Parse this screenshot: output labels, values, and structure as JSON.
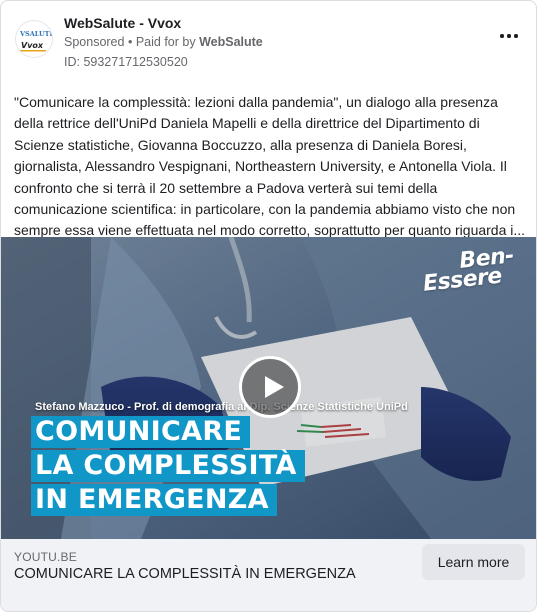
{
  "header": {
    "page_name": "WebSalute - Vvox",
    "sponsored": "Sponsored",
    "separator": "•",
    "paid_for_prefix": "Paid for by",
    "paid_for_by": "WebSalute",
    "ad_id": "ID: 593271712530520",
    "avatar_logo_top": "VSALUTE",
    "avatar_logo_bottom": "Vvox",
    "more_icon": "more-horizontal-icon"
  },
  "post": {
    "text": "\"Comunicare la complessità: lezioni dalla pandemia\", un dialogo alla presenza della rettrice dell'UniPd Daniela Mapelli e della direttrice del Dipartimento di Scienze statistiche, Giovanna Boccuzzo, alla presenza di Daniela Boresi, giornalista, Alessandro Vespignani, Northeastern University, e Antonella Viola. Il confronto che si terrà il 20 settembre a Padova verterà sui temi della comunicazione scientifica: in particolare, con la pandemia abbiamo visto che non sempre essa viene effettuata nel modo corretto, soprattutto per quanto riguarda i..."
  },
  "media": {
    "brand_line1": "Ben-",
    "brand_line2": "Essere",
    "speaker": "Stefano Mazzuco - Prof. di demografia al Dip. Scienze Statistiche UniPd",
    "headline": [
      "COMUNICARE",
      "LA COMPLESSITÀ",
      "IN EMERGENZA"
    ],
    "play_icon": "play-icon",
    "accent_color": "#1196c8"
  },
  "link": {
    "domain": "YOUTU.BE",
    "title": "COMUNICARE LA COMPLESSITÀ IN EMERGENZA",
    "cta": "Learn more"
  }
}
